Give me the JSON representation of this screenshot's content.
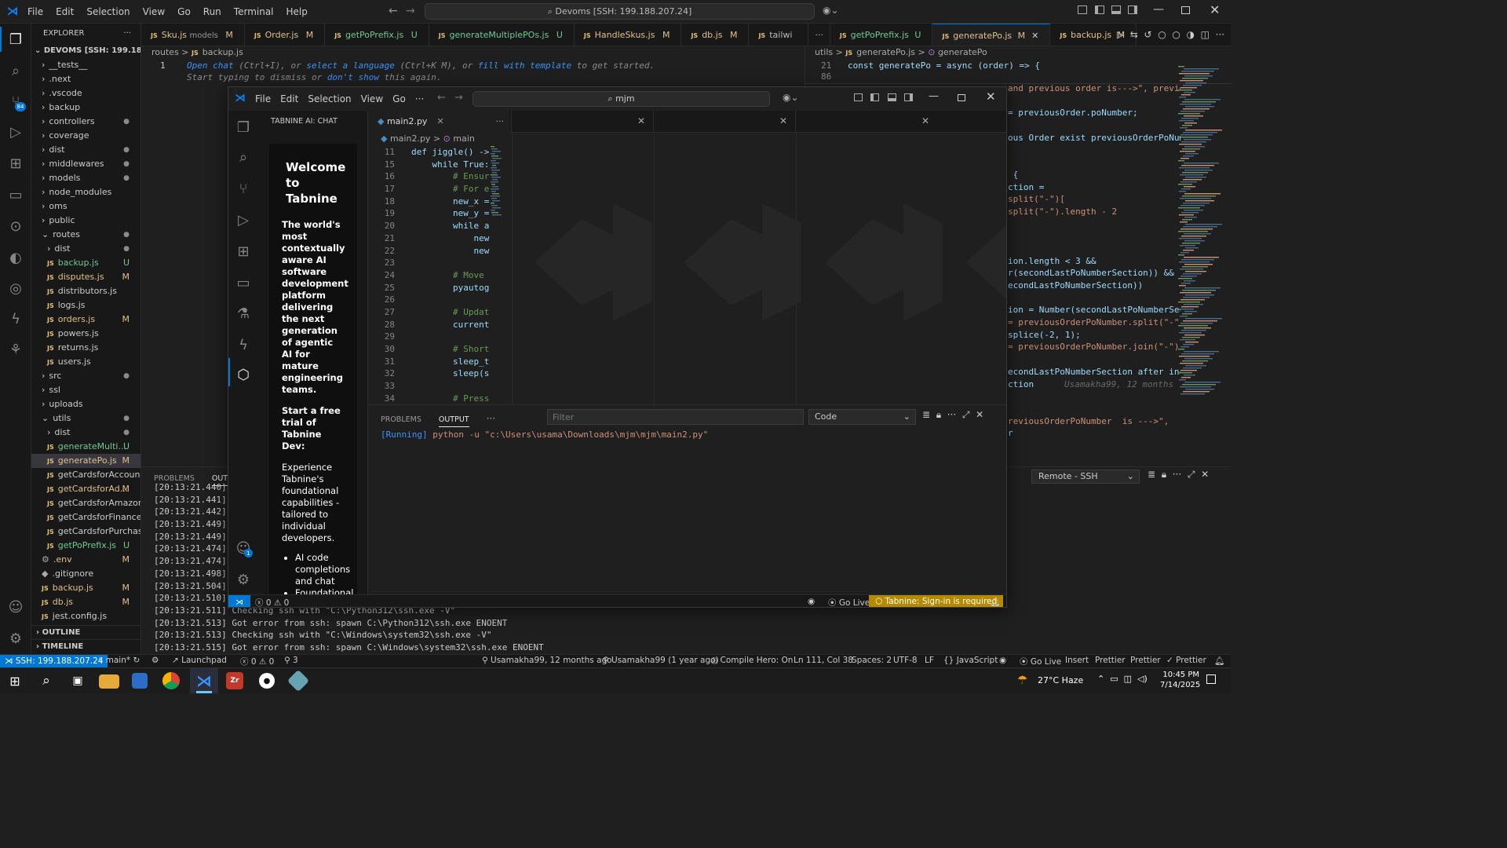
{
  "titlebar": {
    "menu": [
      "File",
      "Edit",
      "Selection",
      "View",
      "Go",
      "Run",
      "Terminal",
      "Help"
    ],
    "search": "Devoms [SSH: 199.188.207.24]"
  },
  "explorer": {
    "header": "EXPLORER",
    "root": "DEVOMS [SSH: 199.188.20...",
    "items": [
      {
        "label": "__tests__",
        "indent": 1,
        "type": "folder",
        "open": false,
        "badge": ""
      },
      {
        "label": ".next",
        "indent": 1,
        "type": "folder",
        "open": false,
        "badge": ""
      },
      {
        "label": ".vscode",
        "indent": 1,
        "type": "folder",
        "open": false,
        "badge": ""
      },
      {
        "label": "backup",
        "indent": 1,
        "type": "folder",
        "open": false,
        "badge": ""
      },
      {
        "label": "controllers",
        "indent": 1,
        "type": "folder",
        "open": false,
        "badge": "dot"
      },
      {
        "label": "coverage",
        "indent": 1,
        "type": "folder",
        "open": false,
        "badge": ""
      },
      {
        "label": "dist",
        "indent": 1,
        "type": "folder",
        "open": false,
        "badge": "dot"
      },
      {
        "label": "middlewares",
        "indent": 1,
        "type": "folder",
        "open": false,
        "badge": "dot"
      },
      {
        "label": "models",
        "indent": 1,
        "type": "folder",
        "open": false,
        "badge": "dot"
      },
      {
        "label": "node_modules",
        "indent": 1,
        "type": "folder",
        "open": false,
        "badge": ""
      },
      {
        "label": "oms",
        "indent": 1,
        "type": "folder",
        "open": false,
        "badge": ""
      },
      {
        "label": "public",
        "indent": 1,
        "type": "folder",
        "open": false,
        "badge": ""
      },
      {
        "label": "routes",
        "indent": 1,
        "type": "folder",
        "open": true,
        "badge": "dot"
      },
      {
        "label": "dist",
        "indent": 2,
        "type": "folder",
        "open": false,
        "badge": "dot"
      },
      {
        "label": "backup.js",
        "indent": 2,
        "type": "js",
        "badge": "U"
      },
      {
        "label": "disputes.js",
        "indent": 2,
        "type": "js",
        "badge": "M"
      },
      {
        "label": "distributors.js",
        "indent": 2,
        "type": "js",
        "badge": ""
      },
      {
        "label": "logs.js",
        "indent": 2,
        "type": "js",
        "badge": ""
      },
      {
        "label": "orders.js",
        "indent": 2,
        "type": "js",
        "badge": "M"
      },
      {
        "label": "powers.js",
        "indent": 2,
        "type": "js",
        "badge": ""
      },
      {
        "label": "returns.js",
        "indent": 2,
        "type": "js",
        "badge": ""
      },
      {
        "label": "users.js",
        "indent": 2,
        "type": "js",
        "badge": ""
      },
      {
        "label": "src",
        "indent": 1,
        "type": "folder",
        "open": false,
        "badge": "dot"
      },
      {
        "label": "ssl",
        "indent": 1,
        "type": "folder",
        "open": false,
        "badge": ""
      },
      {
        "label": "uploads",
        "indent": 1,
        "type": "folder",
        "open": false,
        "badge": ""
      },
      {
        "label": "utils",
        "indent": 1,
        "type": "folder",
        "open": true,
        "badge": "dot"
      },
      {
        "label": "dist",
        "indent": 2,
        "type": "folder",
        "open": false,
        "badge": "dot"
      },
      {
        "label": "generateMulti...",
        "indent": 2,
        "type": "js",
        "badge": "U"
      },
      {
        "label": "generatePo.js",
        "indent": 2,
        "type": "js",
        "badge": "M",
        "selected": true
      },
      {
        "label": "getCardsforAccount.js",
        "indent": 2,
        "type": "js",
        "badge": ""
      },
      {
        "label": "getCardsforAd...",
        "indent": 2,
        "type": "js",
        "badge": "M"
      },
      {
        "label": "getCardsforAmazon.js",
        "indent": 2,
        "type": "js",
        "badge": ""
      },
      {
        "label": "getCardsforFinance.js",
        "indent": 2,
        "type": "js",
        "badge": ""
      },
      {
        "label": "getCardsforPurchasi...",
        "indent": 2,
        "type": "js",
        "badge": ""
      },
      {
        "label": "getPoPrefix.js",
        "indent": 2,
        "type": "js",
        "badge": "U"
      },
      {
        "label": ".env",
        "indent": 1,
        "type": "gear",
        "badge": "M"
      },
      {
        "label": ".gitignore",
        "indent": 1,
        "type": "plain",
        "badge": ""
      },
      {
        "label": "backup.js",
        "indent": 1,
        "type": "js",
        "badge": "M"
      },
      {
        "label": "db.js",
        "indent": 1,
        "type": "js",
        "badge": "M"
      },
      {
        "label": "jest.config.js",
        "indent": 1,
        "type": "js",
        "badge": ""
      }
    ],
    "outline": "OUTLINE",
    "timeline": "TIMELINE"
  },
  "tabs": [
    {
      "label": "Sku.js",
      "desc": "models",
      "badge": "M"
    },
    {
      "label": "Order.js",
      "desc": "",
      "badge": "M"
    },
    {
      "label": "getPoPrefix.js",
      "desc": "",
      "badge": "U"
    },
    {
      "label": "generateMultiplePOs.js",
      "desc": "",
      "badge": "U"
    },
    {
      "label": "HandleSkus.js",
      "desc": "",
      "badge": "M"
    },
    {
      "label": "db.js",
      "desc": "",
      "badge": "M"
    },
    {
      "label": "tailwi",
      "desc": "",
      "badge": ""
    }
  ],
  "tabs_right": [
    {
      "label": "getPoPrefix.js",
      "badge": "U"
    },
    {
      "label": "generatePo.js",
      "badge": "M"
    },
    {
      "label": "backup.js",
      "badge": "M"
    }
  ],
  "editor_left": {
    "breadcrumb": [
      "routes",
      "backup.js"
    ],
    "line_no": "1",
    "hint1_a": "Open chat",
    "hint1_b": " (Ctrl+I), or ",
    "hint1_c": "select a language",
    "hint1_d": " (Ctrl+K M), or ",
    "hint1_e": "fill with template",
    "hint1_f": " to get started.",
    "hint2_a": "Start typing to dismiss or ",
    "hint2_b": "don't show",
    "hint2_c": " this again."
  },
  "editor_right": {
    "breadcrumb": [
      "utils",
      "generatePo.js",
      "generatePo"
    ],
    "line21_no": "21",
    "line21": "const generatePo = async (order) => {",
    "line86_no": "86",
    "lines": [
      {
        "t": "and previous order is--->\", previou"
      },
      {
        "t": ""
      },
      {
        "t": "= previousOrder.poNumber;"
      },
      {
        "t": ""
      },
      {
        "t": "ous Order exist previousOrderPoNum"
      },
      {
        "t": ""
      },
      {
        "t": ""
      },
      {
        "t": " {"
      },
      {
        "t": "ction ="
      },
      {
        "t": "split(\"-\")["
      },
      {
        "t": "split(\"-\").length - 2"
      },
      {
        "t": ""
      },
      {
        "t": ""
      },
      {
        "t": ""
      },
      {
        "t": "ion.length < 3 &&"
      },
      {
        "t": "r(secondLastPoNumberSection)) &&"
      },
      {
        "t": "econdLastPoNumberSection))"
      },
      {
        "t": ""
      },
      {
        "t": "ion = Number(secondLastPoNumberSec"
      },
      {
        "t": "= previousOrderPoNumber.split(\"-\")"
      },
      {
        "t": "splice(-2, 1);"
      },
      {
        "t": "= previousOrderPoNumber.join(\"-\");"
      },
      {
        "t": ""
      },
      {
        "t": "econdLastPoNumberSection after inc"
      },
      {
        "t": "ction"
      },
      {
        "t": ""
      },
      {
        "t": ""
      },
      {
        "t": "reviousOrderPoNumber  is --->\","
      },
      {
        "t": "r"
      }
    ],
    "blame": "Usamakha99, 12 months"
  },
  "bottom_panel": {
    "tabs": [
      "PROBLEMS",
      "OUTPUT"
    ],
    "dropdown": "Remote - SSH",
    "lines": [
      "[20:13:21.440]",
      "[20:13:21.441]",
      "[20:13:21.442]",
      "[20:13:21.449]",
      "[20:13:21.449]",
      "[20:13:21.474]",
      "[20:13:21.474]",
      "[20:13:21.498]",
      "[20:13:21.504]",
      "[20:13:21.510]",
      "[20:13:21.511] Checking ssh with \"C:\\Python312\\ssh.exe -V\"",
      "[20:13:21.513] Got error from ssh: spawn C:\\Python312\\ssh.exe ENOENT",
      "[20:13:21.513] Checking ssh with \"C:\\Windows\\system32\\ssh.exe -V\"",
      "[20:13:21.515] Got error from ssh: spawn C:\\Windows\\system32\\ssh.exe ENOENT"
    ]
  },
  "statusbar": {
    "remote": "SSH: 199.188.207.24",
    "branch": "main*",
    "launchpad": "Launchpad",
    "problems": "0 ⚠ 0",
    "ports": "3",
    "blame_line": "Usamakha99, 12 months ago",
    "blame_file": "Usamakha99 (1 year ago)",
    "compile": "Compile Hero: On",
    "position": "Ln 111, Col 38",
    "spaces": "Spaces: 2",
    "encoding": "UTF-8",
    "eol": "LF",
    "language": "JavaScript",
    "golive": "Go Live",
    "insert": "Insert",
    "prettier1": "Prettier",
    "prettier2": "Prettier",
    "prettier3": "Prettier"
  },
  "window2": {
    "menu": [
      "File",
      "Edit",
      "Selection",
      "View",
      "Go"
    ],
    "search": "mjm",
    "chat_header": "TABNINE AI: CHAT",
    "welcome": "Welcome to Tabnine",
    "tagline": "The world's most contextually aware AI software development platform delivering the next generation of agentic AI for mature engineering teams.",
    "trial": "Start a free trial of Tabnine Dev:",
    "experience": "Experience Tabnine's foundational capabilities - tailored to individual developers.",
    "bullets": [
      "AI code completions and chat",
      "Foundational"
    ],
    "tab": "main2.py",
    "breadcrumb": [
      "main2.py",
      "main"
    ],
    "code": [
      {
        "n": "11",
        "t": "def jiggle() ->"
      },
      {
        "n": "15",
        "t": "    while True:"
      },
      {
        "n": "16",
        "t": "        # Ensur"
      },
      {
        "n": "17",
        "t": "        # For e"
      },
      {
        "n": "18",
        "t": "        new_x ="
      },
      {
        "n": "19",
        "t": "        new_y ="
      },
      {
        "n": "20",
        "t": "        while a"
      },
      {
        "n": "21",
        "t": "            new"
      },
      {
        "n": "22",
        "t": "            new"
      },
      {
        "n": "23",
        "t": ""
      },
      {
        "n": "24",
        "t": "        # Move"
      },
      {
        "n": "25",
        "t": "        pyautog"
      },
      {
        "n": "26",
        "t": ""
      },
      {
        "n": "27",
        "t": "        # Updat"
      },
      {
        "n": "28",
        "t": "        current"
      },
      {
        "n": "29",
        "t": ""
      },
      {
        "n": "30",
        "t": "        # Short"
      },
      {
        "n": "31",
        "t": "        sleep_t"
      },
      {
        "n": "32",
        "t": "        sleep(s"
      },
      {
        "n": "33",
        "t": ""
      },
      {
        "n": "34",
        "t": "        # Press"
      }
    ],
    "panel_tabs": [
      "PROBLEMS",
      "OUTPUT"
    ],
    "filter_placeholder": "Filter",
    "dropdown": "Code",
    "running_tag": "[Running]",
    "running_cmd": " python -u \"c:\\Users\\usama\\Downloads\\mjm\\mjm\\main2.py\"",
    "status_problems": "0 ⚠ 0",
    "status_golive": "Go Live",
    "status_tabnine": "Tabnine: Sign-in is required",
    "account_badge": "1"
  },
  "taskbar": {
    "weather": "27°C  Haze",
    "time": "10:45 PM",
    "date": "7/14/2025",
    "activity_badge": "84"
  }
}
